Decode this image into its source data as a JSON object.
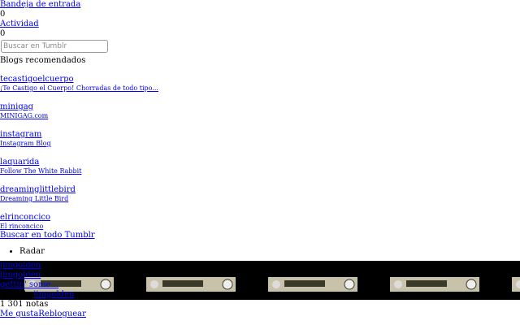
{
  "nav": {
    "inbox": {
      "label": "Bandeja de entrada",
      "count": "0"
    },
    "activity": {
      "label": "Actividad",
      "count": "0"
    }
  },
  "search": {
    "placeholder": "Buscar en Tumblr"
  },
  "recommended": {
    "heading": "Blogs recomendados",
    "blogs": [
      {
        "name": "tecastigoelcuerpo",
        "title": "¡Te Castigo el Cuerpo! Chorradas de todo tipo..."
      },
      {
        "name": "minigag",
        "title": "MINIGAG.com"
      },
      {
        "name": "instagram",
        "title": "Instagram Blog"
      },
      {
        "name": "laquarida",
        "title": "Follow The White Rabbit"
      },
      {
        "name": "dreaminglittlebird",
        "title": "Dreaming Little Bird"
      },
      {
        "name": "elrinconcico",
        "title": "El rinconcico"
      }
    ],
    "search_all": "Buscar en todo Tumblr"
  },
  "radar": {
    "heading": "Radar",
    "post": {
      "author_top": "jimgolden",
      "author": "jimgolden",
      "caption": "gettin' some...",
      "type_label": "Foto de ",
      "type_author": "jimgolden",
      "notes": "1 301 notas",
      "like": "Me gusta",
      "reblog": "Rebloguear"
    }
  },
  "colors": {
    "link": "#0000ee",
    "strip_background": "#000000",
    "deck_body": "#c8c2aa",
    "deck_detail": "#3a3a2a"
  }
}
